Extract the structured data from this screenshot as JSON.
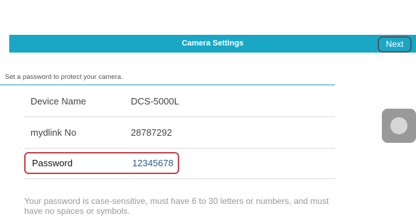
{
  "header": {
    "title": "Camera Settings",
    "next_label": "Next"
  },
  "form": {
    "caption": "Set a password to protect your camera.",
    "device_name": {
      "label": "Device Name",
      "value": "DCS-5000L"
    },
    "mydlink_no": {
      "label": "mydlink No",
      "value": "28787292"
    },
    "password": {
      "label": "Password",
      "value": "12345678"
    },
    "hint": "Your password is case-sensitive, must have 6 to 30 letters or numbers, and must have no spaces or symbols."
  },
  "colors": {
    "header_bg": "#1aa7c6",
    "password_highlight": "#c4454c",
    "password_value": "#2f5b8c"
  },
  "icons": {
    "assistive_touch": "assistive-touch-icon"
  }
}
